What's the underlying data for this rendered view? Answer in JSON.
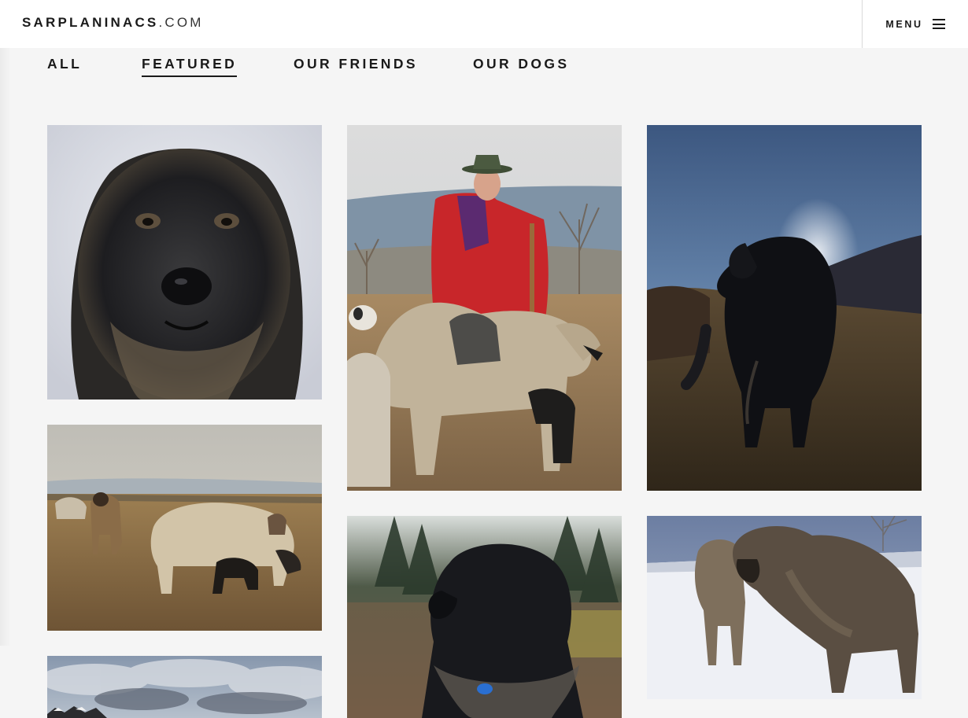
{
  "header": {
    "logo_brand": "SARPLANINACS",
    "logo_tld": ".COM",
    "menu_label": "MENU"
  },
  "filters": [
    {
      "label": "ALL",
      "active": false
    },
    {
      "label": "FEATURED",
      "active": true
    },
    {
      "label": "OUR FRIENDS",
      "active": false
    },
    {
      "label": "OUR DOGS",
      "active": false
    }
  ],
  "gallery": {
    "photos": [
      {
        "subject": "dark dog portrait in snow"
      },
      {
        "subject": "shepherd with dogs and sheep"
      },
      {
        "subject": "black dog on hillside at sunset"
      },
      {
        "subject": "sheep and dog in field"
      },
      {
        "subject": "black dog in forest"
      },
      {
        "subject": "two dogs in snow"
      },
      {
        "subject": "cloudy sky landscape"
      }
    ]
  },
  "colors": {
    "accent": "#1a1a1a",
    "background": "#f5f5f5",
    "header": "#ffffff"
  }
}
